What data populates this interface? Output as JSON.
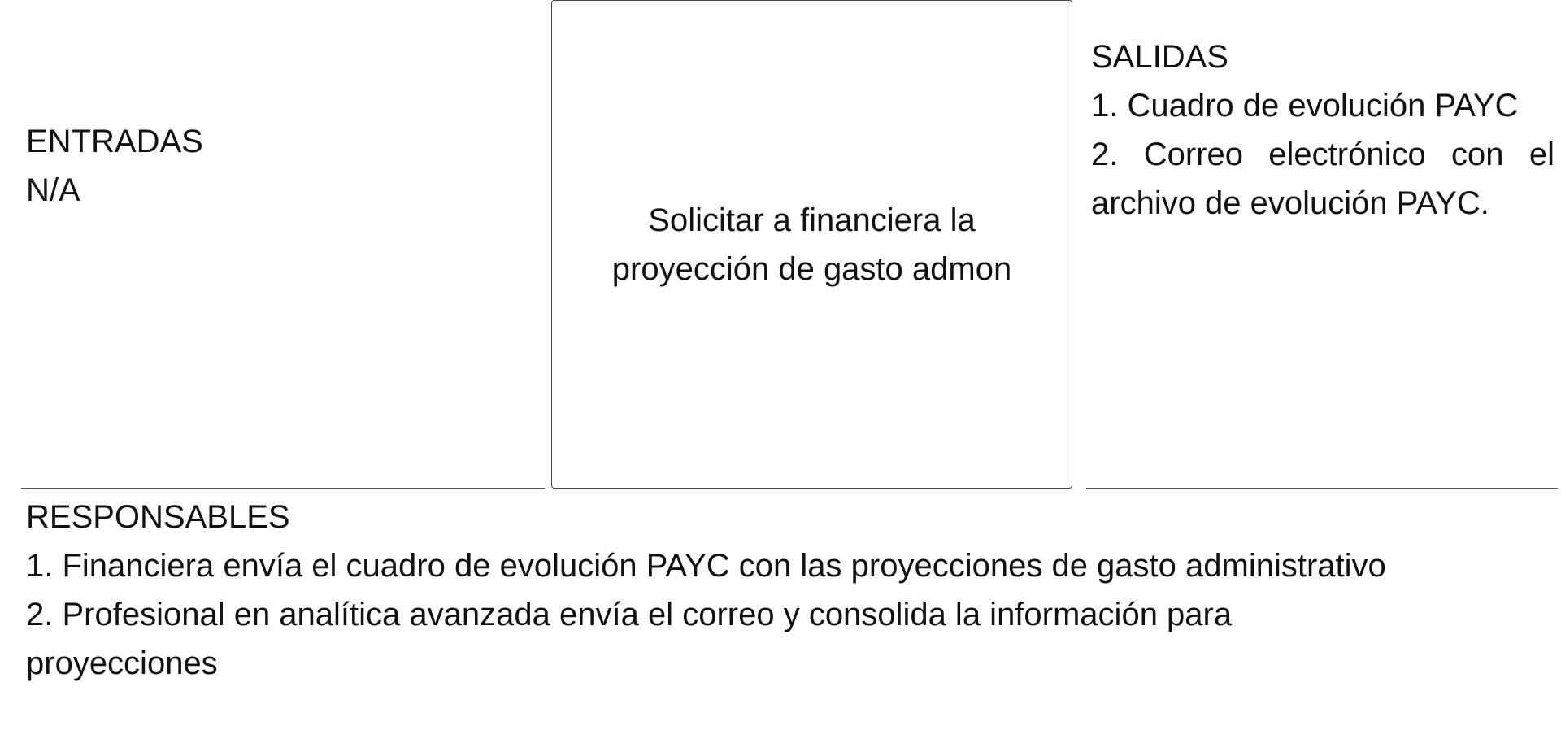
{
  "entradas": {
    "title": "ENTRADAS",
    "value": "N/A"
  },
  "process": {
    "text": "Solicitar a financiera la proyección de gasto admon"
  },
  "salidas": {
    "title": "SALIDAS",
    "items": [
      "1. Cuadro de evolución PAYC",
      "2. Correo electrónico con el archivo de evolución PAYC."
    ]
  },
  "responsables": {
    "title": "RESPONSABLES",
    "items": [
      "1. Financiera envía el cuadro de evolución PAYC con las proyecciones de gasto administrativo",
      "2. Profesional en analítica avanzada envía el correo y consolida la información para proyecciones"
    ]
  }
}
